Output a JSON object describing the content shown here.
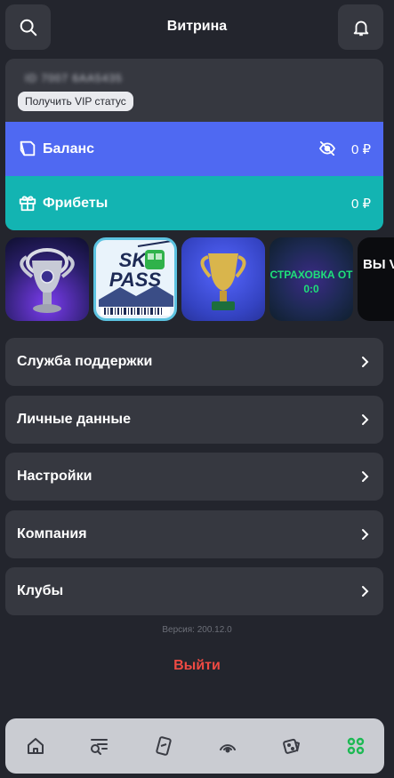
{
  "header": {
    "title": "Витрина",
    "search_icon": "search-icon",
    "bell_icon": "bell-icon"
  },
  "account": {
    "id_masked": "ID 7007 6AA5435",
    "vip_label": "Получить VIP статус"
  },
  "balance": {
    "label": "Баланс",
    "value": "0 ₽",
    "icon": "wallet-icon",
    "visibility_icon": "eye-off-icon"
  },
  "freebets": {
    "label": "Фрибеты",
    "value": "0 ₽",
    "icon": "gift-icon"
  },
  "stories": [
    {
      "name": "champions-league-cup-story",
      "text": ""
    },
    {
      "name": "ski-pass-story",
      "text": "SKI PASS"
    },
    {
      "name": "trophy-story",
      "text": ""
    },
    {
      "name": "insurance-story",
      "text": "СТРАХОВКА ОТ 0:0"
    },
    {
      "name": "vip-status-story",
      "text": "ВЫ VI СТА"
    }
  ],
  "menu": [
    {
      "label": "Служба поддержки"
    },
    {
      "label": "Личные данные"
    },
    {
      "label": "Настройки"
    },
    {
      "label": "Компания"
    },
    {
      "label": "Клубы"
    }
  ],
  "version": "Версия:  200.12.0",
  "logout_label": "Выйти",
  "colors": {
    "background": "#23252d",
    "card": "#363840",
    "balance": "#4f69f2",
    "freebets": "#13b4b2",
    "logout": "#ef4a43",
    "tab_active": "#1db954"
  },
  "tabbar": {
    "tabs": [
      {
        "icon": "home-icon",
        "active": false
      },
      {
        "icon": "sports-search-icon",
        "active": false
      },
      {
        "icon": "coupons-icon",
        "active": false
      },
      {
        "icon": "live-icon",
        "active": false
      },
      {
        "icon": "casino-dice-icon",
        "active": false
      },
      {
        "icon": "grid-menu-icon",
        "active": true
      }
    ]
  }
}
